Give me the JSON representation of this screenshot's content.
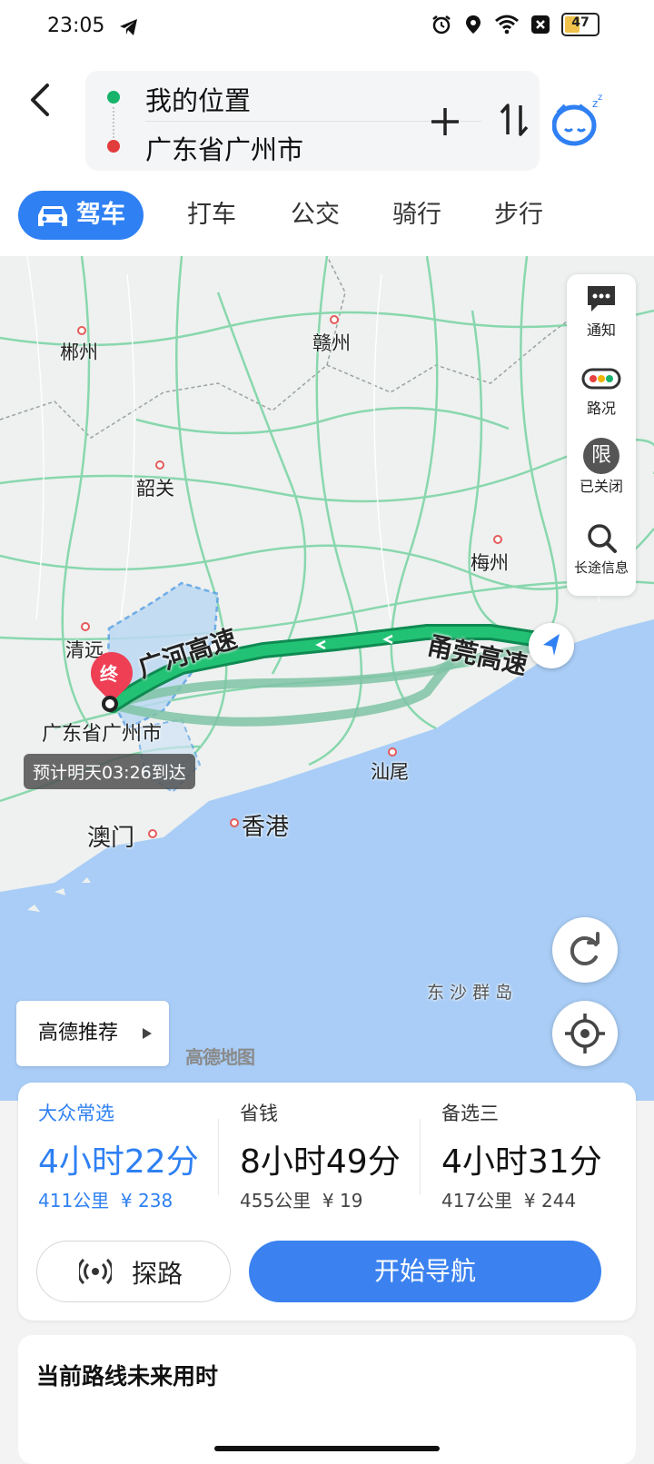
{
  "status_bar": {
    "time": "23:05",
    "battery_level": "47",
    "icons": [
      "telegram-icon",
      "alarm-icon",
      "location-icon",
      "wifi-icon",
      "dnd-icon",
      "battery-icon"
    ]
  },
  "header": {
    "start": "我的位置",
    "end": "广东省广州市"
  },
  "modes": {
    "items": [
      "驾车",
      "打车",
      "公交",
      "骑行",
      "步行"
    ],
    "selected": 0
  },
  "map": {
    "cities": [
      "郴州",
      "赣州",
      "韶关",
      "梅州",
      "清远",
      "汕尾",
      "澳门",
      "香港"
    ],
    "islands_label": "东 沙 群 岛",
    "destination_label": "广东省广州市",
    "destination_marker": "终",
    "eta": "预计明天03:26到达",
    "road_labels": [
      "广河高速",
      "甬莞高速"
    ],
    "side_panel": [
      "通知",
      "路况",
      "已关闭",
      "长途信息"
    ],
    "limit_icon_text": "限",
    "recommend_label": "高德推荐",
    "logo": "高德地图"
  },
  "routes": [
    {
      "name": "大众常选",
      "duration": "4小时22分",
      "distance": "411公里",
      "cost": "¥ 238",
      "selected": true
    },
    {
      "name": "省钱",
      "duration": "8小时49分",
      "distance": "455公里",
      "cost": "¥ 19",
      "selected": false
    },
    {
      "name": "备选三",
      "duration": "4小时31分",
      "distance": "417公里",
      "cost": "¥ 244",
      "selected": false
    }
  ],
  "actions": {
    "probe": "探路",
    "navigate": "开始导航"
  },
  "future": {
    "title": "当前路线未来用时"
  },
  "colors": {
    "accent": "#2f80f3",
    "route_main": "#12b36b",
    "route_alt": "#7fc3a4",
    "sea": "#a9cdf6",
    "land": "#eef1ef"
  }
}
